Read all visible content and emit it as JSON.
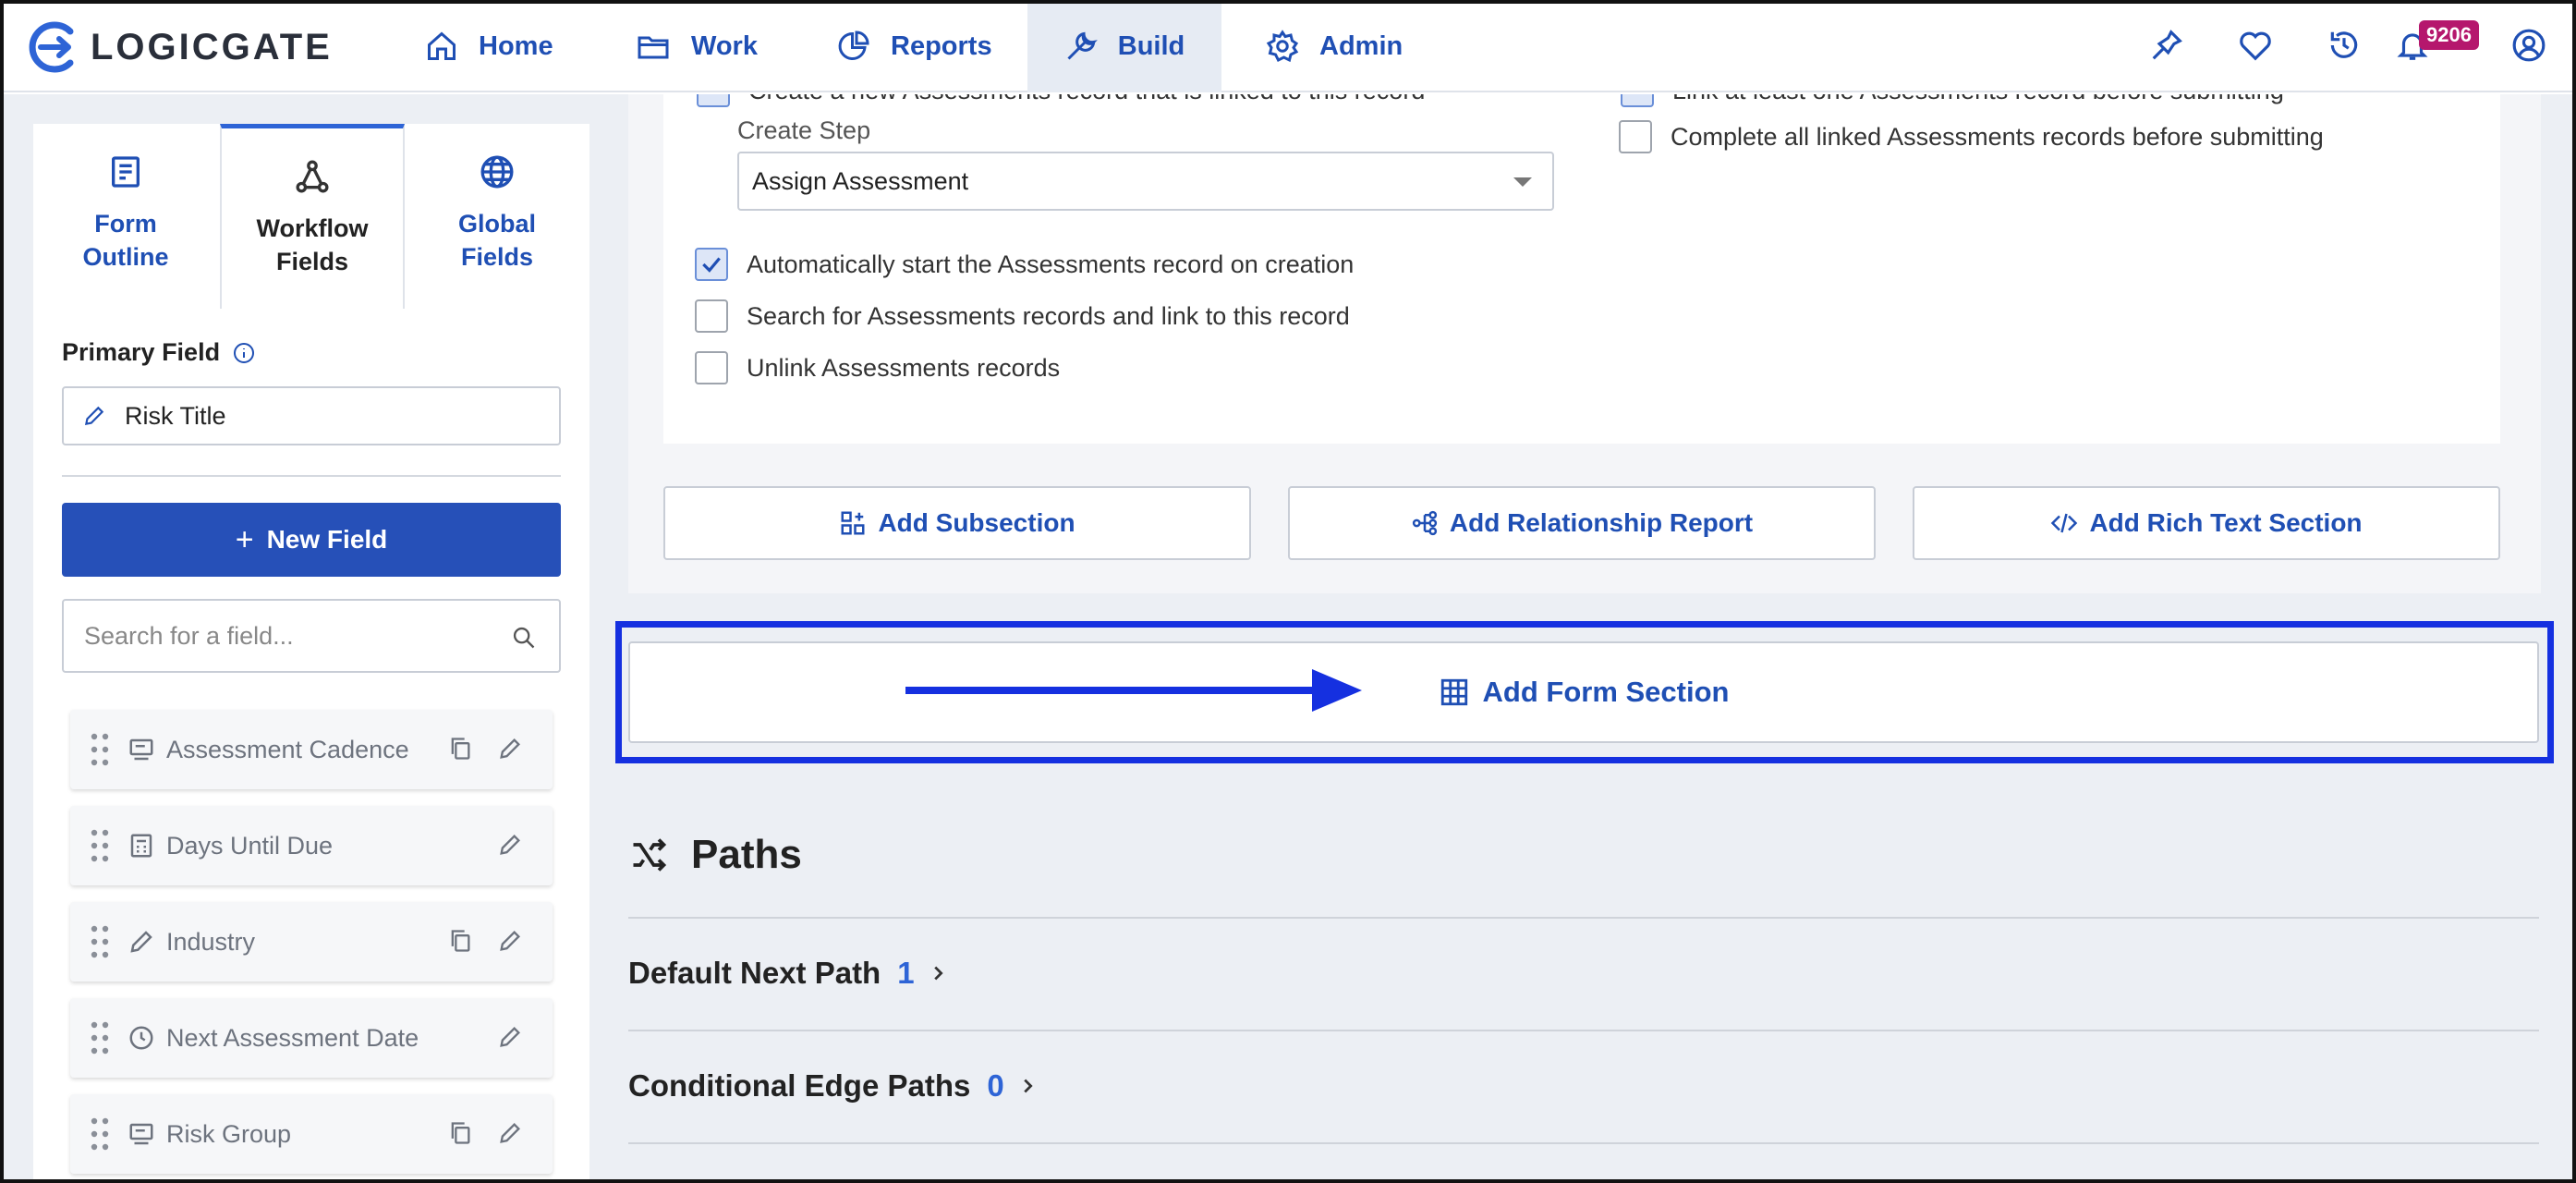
{
  "app": {
    "logo_text": "LOGICGATE"
  },
  "nav": {
    "items": [
      {
        "label": "Home",
        "icon": "home-icon"
      },
      {
        "label": "Work",
        "icon": "folder-icon"
      },
      {
        "label": "Reports",
        "icon": "pie-chart-icon"
      },
      {
        "label": "Build",
        "icon": "wrench-icon"
      },
      {
        "label": "Admin",
        "icon": "gear-icon"
      }
    ],
    "active": "Build",
    "notification_count": "9206"
  },
  "left_panel": {
    "tabs": [
      {
        "label_line1": "Form",
        "label_line2": "Outline"
      },
      {
        "label_line1": "Workflow",
        "label_line2": "Fields"
      },
      {
        "label_line1": "Global",
        "label_line2": "Fields"
      }
    ],
    "active_tab": "Workflow Fields",
    "primary_field_label": "Primary Field",
    "primary_field_value": "Risk Title",
    "new_field_label": "New Field",
    "search_placeholder": "Search for a field...",
    "fields": [
      {
        "name": "Assessment Cadence",
        "icon": "select-icon",
        "copyable": true
      },
      {
        "name": "Days Until Due",
        "icon": "calculator-icon",
        "copyable": false
      },
      {
        "name": "Industry",
        "icon": "pencil-icon",
        "copyable": true
      },
      {
        "name": "Next Assessment Date",
        "icon": "clock-icon",
        "copyable": false
      },
      {
        "name": "Risk Group",
        "icon": "select-icon",
        "copyable": true
      }
    ]
  },
  "config": {
    "top_left_cut": "Create a new Assessments record that is linked to this record",
    "top_right_cut": "Link at least one Assessments record before submitting",
    "complete_all": "Complete all linked Assessments records before submitting",
    "create_step_label": "Create Step",
    "create_step_value": "Assign Assessment",
    "auto_start": "Automatically start the Assessments record on creation",
    "search_link": "Search for Assessments records and link to this record",
    "unlink": "Unlink Assessments records"
  },
  "section_buttons": {
    "add_subsection": "Add Subsection",
    "add_relationship_report": "Add Relationship Report",
    "add_rich_text": "Add Rich Text Section"
  },
  "add_form_section": "Add Form Section",
  "paths": {
    "title": "Paths",
    "default_next": {
      "label": "Default Next Path",
      "count": "1"
    },
    "conditional_edge": {
      "label": "Conditional Edge Paths",
      "count": "0"
    }
  },
  "colors": {
    "accent": "#1f4fb4",
    "primary_button": "#2650b8",
    "highlight": "#1530e0",
    "badge": "#b5176d"
  }
}
